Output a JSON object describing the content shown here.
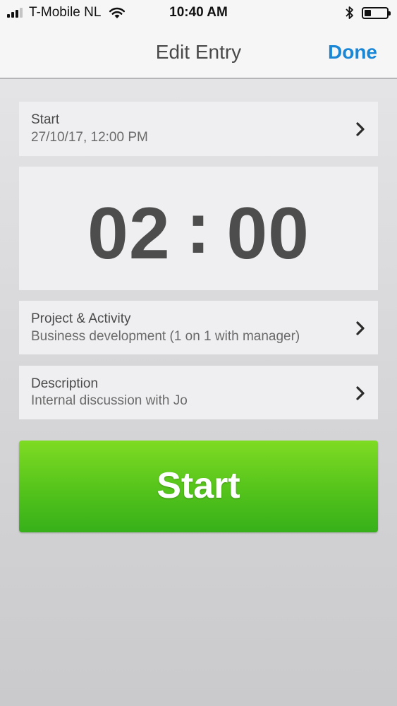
{
  "status_bar": {
    "carrier": "T-Mobile NL",
    "time": "10:40 AM",
    "icons": [
      "signal-icon",
      "wifi-icon",
      "bluetooth-icon",
      "battery-icon"
    ]
  },
  "nav": {
    "title": "Edit Entry",
    "done_label": "Done"
  },
  "start_row": {
    "label": "Start",
    "value": "27/10/17, 12:00 PM"
  },
  "timer": {
    "hours": "02",
    "separator": ":",
    "minutes": "00"
  },
  "project_row": {
    "label": "Project & Activity",
    "value": "Business development (1 on 1 with manager)"
  },
  "description_row": {
    "label": "Description",
    "value": "Internal discussion with Jo"
  },
  "start_button": {
    "label": "Start"
  },
  "colors": {
    "accent_blue": "#1a86d6",
    "start_green": "#54c31b",
    "text_gray": "#4a4a4a"
  }
}
